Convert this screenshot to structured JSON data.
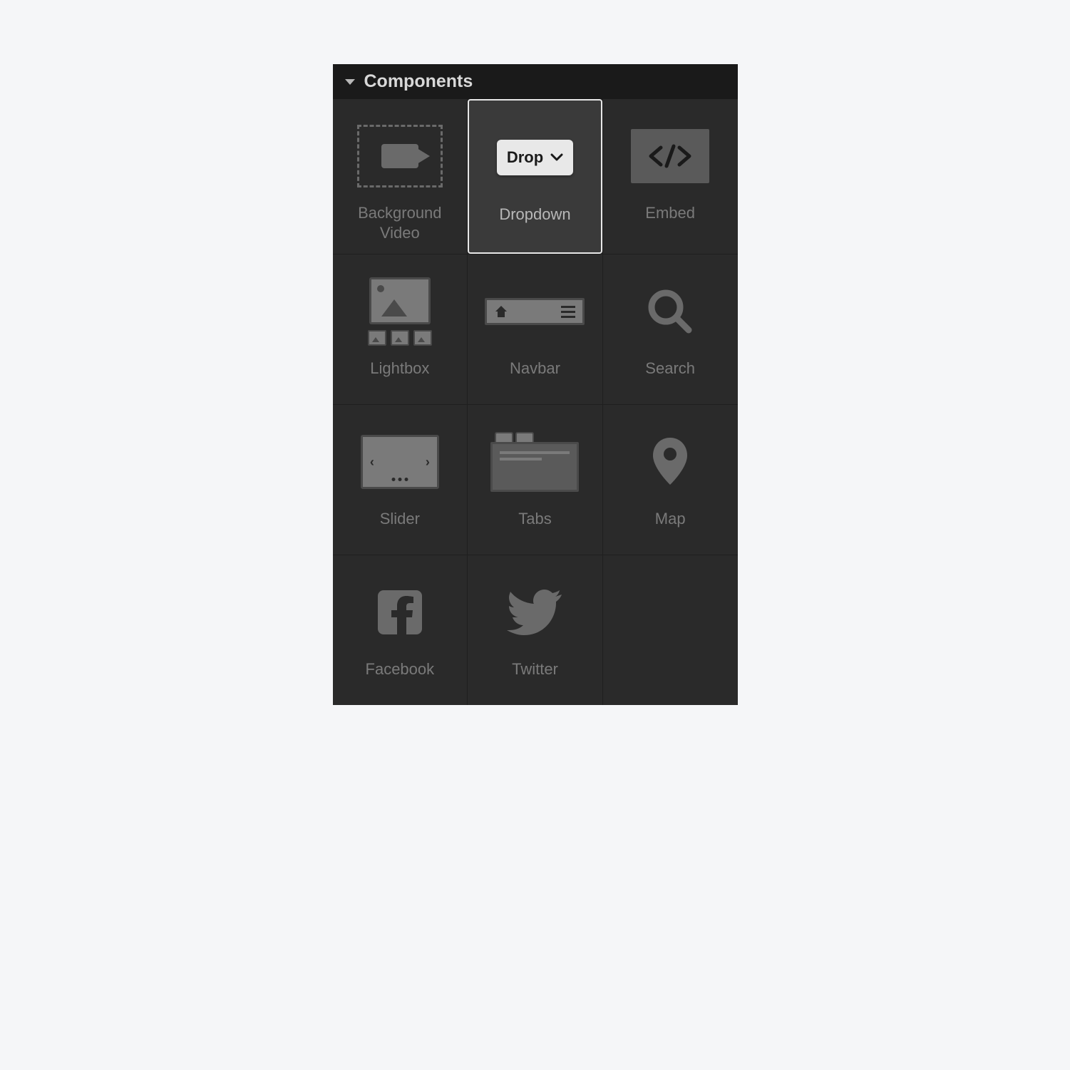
{
  "panel": {
    "title": "Components",
    "selected_index": 1,
    "items": [
      {
        "id": "background-video",
        "label": "Background Video"
      },
      {
        "id": "dropdown",
        "label": "Dropdown",
        "badge_text": "Drop"
      },
      {
        "id": "embed",
        "label": "Embed"
      },
      {
        "id": "lightbox",
        "label": "Lightbox"
      },
      {
        "id": "navbar",
        "label": "Navbar"
      },
      {
        "id": "search",
        "label": "Search"
      },
      {
        "id": "slider",
        "label": "Slider"
      },
      {
        "id": "tabs",
        "label": "Tabs"
      },
      {
        "id": "map",
        "label": "Map"
      },
      {
        "id": "facebook",
        "label": "Facebook"
      },
      {
        "id": "twitter",
        "label": "Twitter"
      }
    ]
  }
}
